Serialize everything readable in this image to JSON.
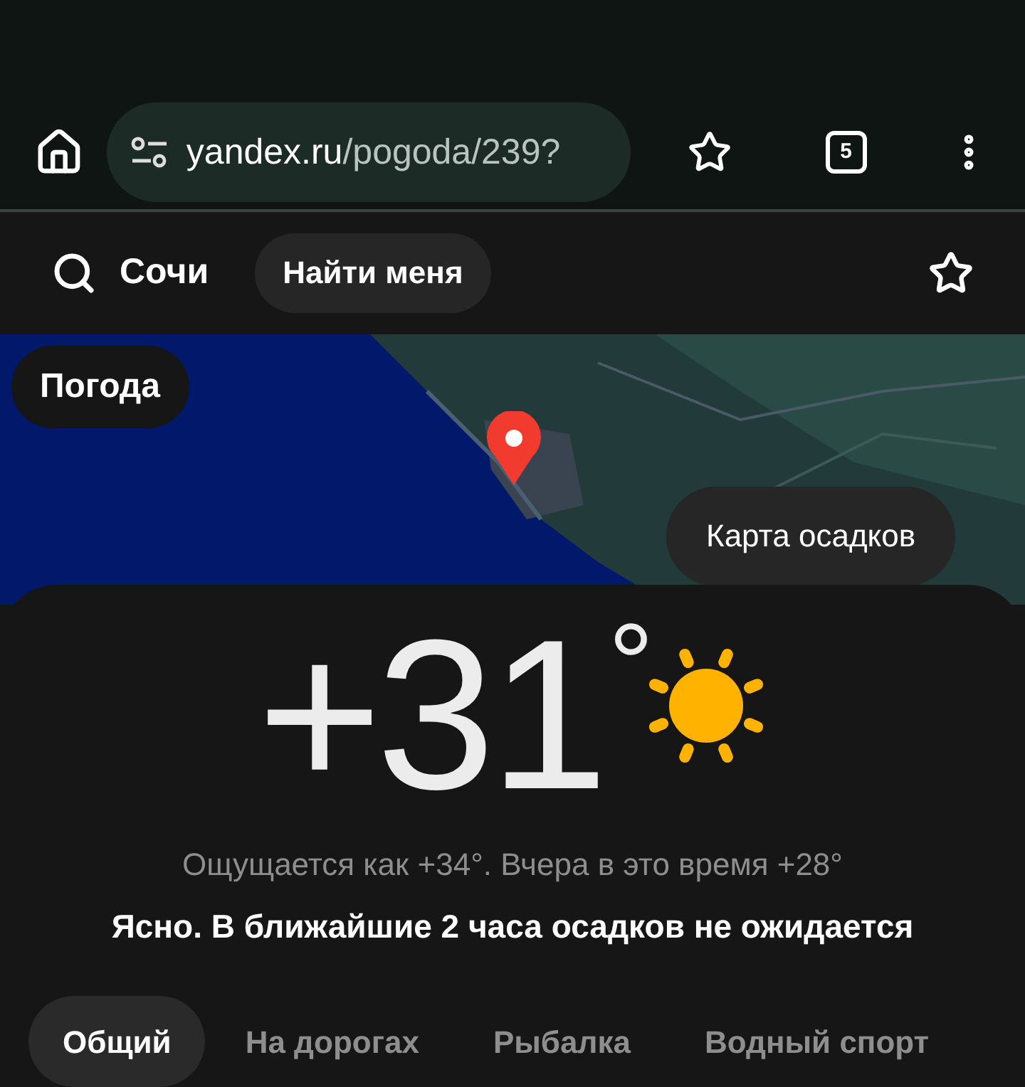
{
  "browser": {
    "url_host": "yandex.ru",
    "url_path": "/pogoda/239?",
    "tab_count": "5"
  },
  "header": {
    "city": "Сочи",
    "locate_button": "Найти меня"
  },
  "map": {
    "kind": "picture",
    "badge": "Погода",
    "radar_button": "Карта осадков"
  },
  "current": {
    "temperature": "+31",
    "degree": "°",
    "feels_like": "Ощущается как +34°. Вчера в это время +28°",
    "summary": "Ясно. В ближайшие 2 часа осадков не ожидается"
  },
  "tabs": [
    {
      "label": "Общий",
      "selected": true
    },
    {
      "label": "На дорогах",
      "selected": false
    },
    {
      "label": "Рыбалка",
      "selected": false
    },
    {
      "label": "Водный спорт",
      "selected": false
    }
  ]
}
